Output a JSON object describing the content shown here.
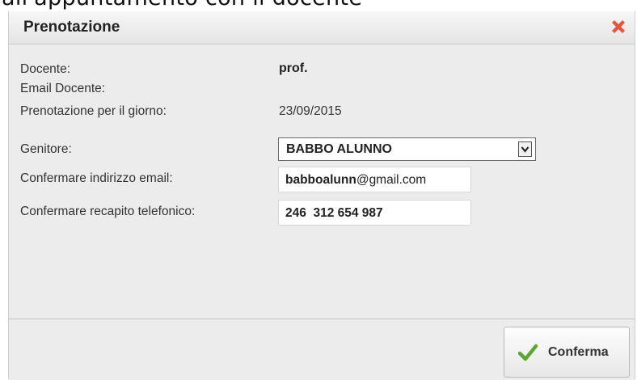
{
  "caption": "all'appuntamento con il docente",
  "dialog": {
    "title": "Prenotazione",
    "fields": {
      "docente_label": "Docente:",
      "docente_value": "prof.",
      "email_docente_label": "Email Docente:",
      "email_docente_value": "",
      "giorno_label": "Prenotazione per il giorno:",
      "giorno_value": "23/09/2015",
      "genitore_label": "Genitore:",
      "genitore_value": "BABBO ALUNNO",
      "email_label": "Confermare indirizzo email:",
      "email_value_bold": "babboalunn",
      "email_value_rest": "@gmail.com",
      "telefono_label": "Confermare recapito telefonico:",
      "telefono_value": "246  312 654 987"
    },
    "confirm_label": "Conferma"
  },
  "icons": {
    "close": "close-icon",
    "check": "check-icon",
    "dropdown": "chevron-down-icon"
  },
  "colors": {
    "close": "#e8553f",
    "check": "#5aa832",
    "dialog_bg": "#ececec"
  }
}
